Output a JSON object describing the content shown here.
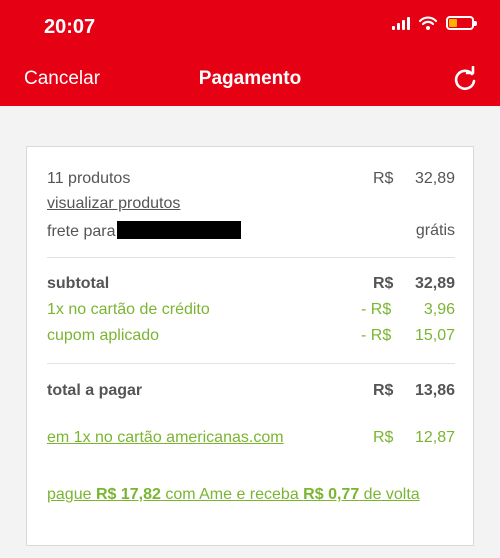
{
  "status_bar": {
    "time": "20:07"
  },
  "header": {
    "cancel_label": "Cancelar",
    "title": "Pagamento"
  },
  "summary": {
    "products_label": "11 produtos",
    "products_currency": "R$",
    "products_value": "32,89",
    "view_products_link": "visualizar produtos",
    "shipping_label": "frete para",
    "shipping_value": "grátis"
  },
  "totals": {
    "subtotal_label": "subtotal",
    "subtotal_currency": "R$",
    "subtotal_value": "32,89",
    "credit_label": "1x no cartão de crédito",
    "credit_currency": "- R$",
    "credit_value": "3,96",
    "coupon_label": "cupom aplicado",
    "coupon_currency": "- R$",
    "coupon_value": "15,07"
  },
  "payment": {
    "total_label": "total a pagar",
    "total_currency": "R$",
    "total_value": "13,86",
    "card_option_label": "em 1x no cartão americanas.com",
    "card_option_currency": "R$",
    "card_option_value": "12,87"
  },
  "ame_offer": {
    "prefix": "pague ",
    "amount": "R$ 17,82",
    "middle": " com Ame e receba ",
    "cashback": "R$ 0,77",
    "suffix": " de volta"
  },
  "colors": {
    "brand_red": "#e60014",
    "accent_green": "#7ab532",
    "text_gray": "#555555"
  }
}
